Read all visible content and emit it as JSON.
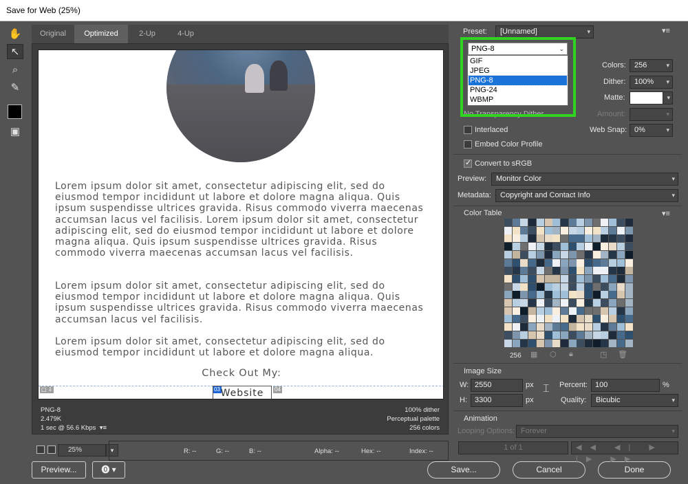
{
  "window": {
    "title": "Save for Web (25%)"
  },
  "tools": [
    {
      "name": "hand-tool-icon",
      "glyph": "✋"
    },
    {
      "name": "slice-select-tool-icon",
      "glyph": "↖"
    },
    {
      "name": "zoom-tool-icon",
      "glyph": "🔍"
    },
    {
      "name": "eyedropper-tool-icon",
      "glyph": "✎"
    },
    {
      "name": "toggle-slices-icon",
      "glyph": "▣"
    }
  ],
  "tabs": [
    "Original",
    "Optimized",
    "2-Up",
    "4-Up"
  ],
  "preview": {
    "paragraph1": "Lorem ipsum dolor sit amet, consectetur adipiscing elit, sed do eiusmod tempor incididunt ut labore et dolore magna aliqua. Quis ipsum suspendisse ultrices gravida. Risus commodo viverra maecenas accumsan lacus vel facilisis. Lorem ipsum dolor sit amet, consectetur adipiscing elit, sed do eiusmod tempor incididunt ut labore et dolore magna aliqua. Quis ipsum suspendisse ultrices gravida. Risus commodo viverra maecenas accumsan lacus vel facilisis.",
    "paragraph2": "Lorem ipsum dolor sit amet, consectetur adipiscing elit, sed do eiusmod tempor incididunt ut labore et dolore magna aliqua. Quis ipsum suspendisse ultrices gravida. Risus commodo viverra maecenas accumsan lacus vel facilisis.",
    "paragraph3": "Lorem ipsum dolor sit amet, consectetur adipiscing elit, sed do eiusmod tempor incididunt ut labore et dolore magna aliqua.",
    "checkout": "Check Out My:",
    "website": "Website",
    "slice_labels": [
      "03",
      "04"
    ],
    "info_left": [
      "PNG-8",
      "2.479K",
      "1 sec @ 56.6 Kbps"
    ],
    "info_right": [
      "100% dither",
      "Perceptual palette",
      "256 colors"
    ]
  },
  "bottom": {
    "zoom": "25%",
    "readouts": [
      "R: --",
      "G: --",
      "B: --",
      "Alpha: --",
      "Hex: --",
      "Index: --"
    ],
    "preview_button": "Preview...",
    "save_button": "Save...",
    "cancel_button": "Cancel",
    "done_button": "Done"
  },
  "settings": {
    "preset_label": "Preset:",
    "preset_value": "[Unnamed]",
    "format_value": "PNG-8",
    "format_options": [
      "GIF",
      "JPEG",
      "PNG-8",
      "PNG-24",
      "WBMP"
    ],
    "format_selected_index": 2,
    "colors_label": "Colors:",
    "colors_value": "256",
    "dither_label": "Dither:",
    "dither_value": "100%",
    "matte_label": "Matte:",
    "amount_label": "Amount:",
    "transparency_dither": "No Transparency Dither",
    "interlaced": "Interlaced",
    "embed_profile": "Embed Color Profile",
    "web_snap_label": "Web Snap:",
    "web_snap_value": "0%",
    "convert_srgb": "Convert to sRGB",
    "preview_label": "Preview:",
    "preview_value": "Monitor Color",
    "metadata_label": "Metadata:",
    "metadata_value": "Copyright and Contact Info"
  },
  "color_table": {
    "title": "Color Table",
    "count": "256",
    "palette": [
      "#2f4f6e",
      "#9fbfd9",
      "#c7d7e5",
      "#f3e3c6",
      "#1d2b3a",
      "#7d95ad",
      "#e9dcc9",
      "#456a8c",
      "#b8cfe1",
      "#3b4d5e",
      "#d6c6b0",
      "#5d7b97",
      "#0f1c29",
      "#eef2f6",
      "#8aa6bf",
      "#6e6e6e",
      "#c4b59e",
      "#243647",
      "#a3b5c4",
      "#f8efe0"
    ]
  },
  "image_size": {
    "title": "Image Size",
    "w_label": "W:",
    "w_value": "2550",
    "h_label": "H:",
    "h_value": "3300",
    "unit": "px",
    "percent_label": "Percent:",
    "percent_value": "100",
    "percent_unit": "%",
    "quality_label": "Quality:",
    "quality_value": "Bicubic"
  },
  "animation": {
    "title": "Animation",
    "looping_label": "Looping Options:",
    "looping_value": "Forever",
    "frame": "1 of 1"
  }
}
